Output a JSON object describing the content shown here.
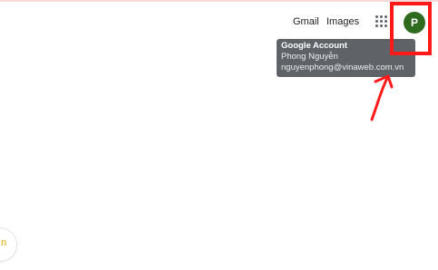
{
  "header": {
    "gmail_label": "Gmail",
    "images_label": "Images",
    "apps_icon": "apps-grid-icon",
    "avatar_initial": "P"
  },
  "account_tooltip": {
    "title": "Google Account",
    "name": "Phong Nguyễn",
    "email": "nguyenphong@vinaweb.com.vn"
  },
  "floating_button": {
    "glyph": "n"
  },
  "colors": {
    "avatar": "#2e6b1f",
    "tooltip_bg": "#5f6368",
    "annotation": "#ff1a1a"
  }
}
